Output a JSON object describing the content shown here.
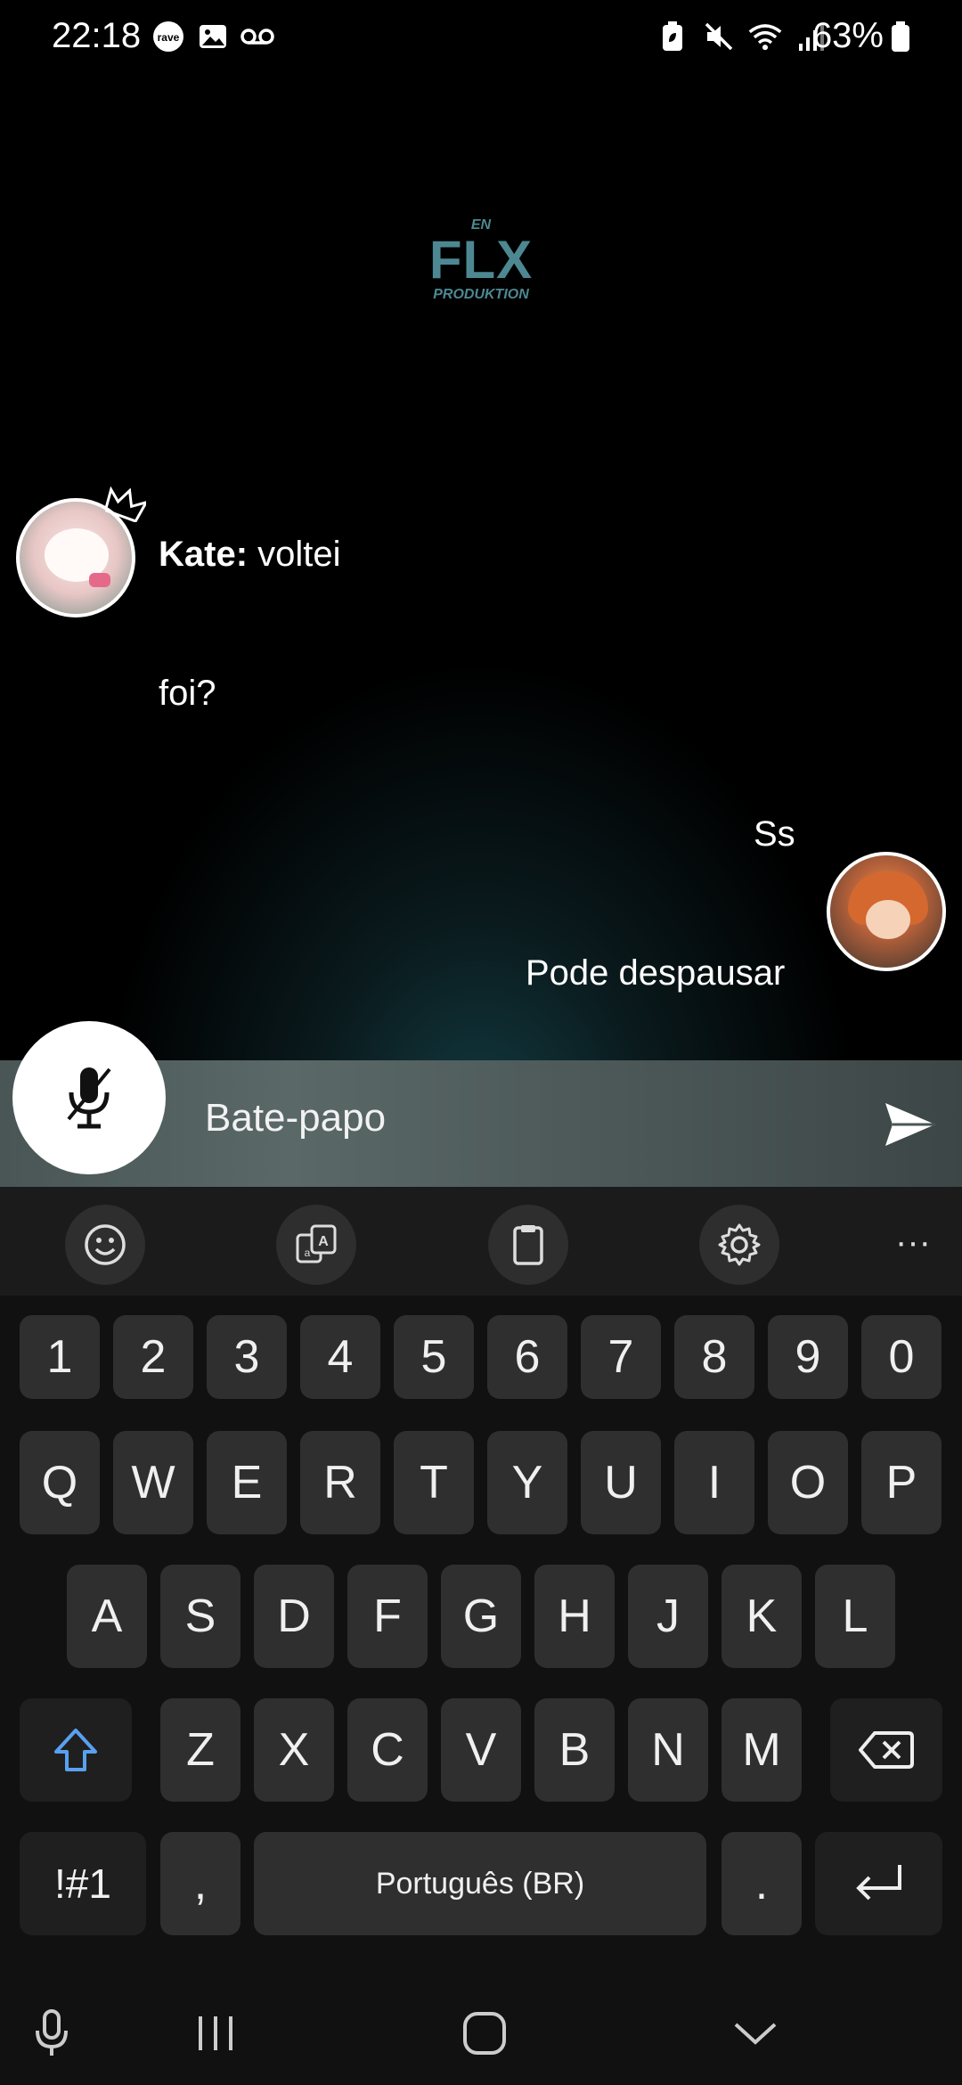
{
  "status_bar": {
    "time": "22:18",
    "battery": "63%",
    "left_icons": [
      "rave-icon",
      "image-icon",
      "voicemail-icon"
    ],
    "right_icons": [
      "battery-saver-icon",
      "mute-icon",
      "wifi-icon",
      "signal-icon"
    ]
  },
  "logo": {
    "top": "EN",
    "main": "FLX",
    "bottom": "PRODUKTION",
    "color": "#4d8892"
  },
  "messages": [
    {
      "side": "left",
      "author": "Kate:",
      "text": " voltei",
      "has_avatar": true,
      "crown": true
    },
    {
      "side": "left",
      "author": "",
      "text": "foi?",
      "has_avatar": false
    },
    {
      "side": "right",
      "author": "",
      "text": "Ss",
      "has_avatar": true
    },
    {
      "side": "right",
      "author": "",
      "text": "Pode despausar",
      "has_avatar": false
    }
  ],
  "input": {
    "placeholder": "Bate-papo",
    "mic_state": "muted",
    "send_icon": "send-icon"
  },
  "keyboard": {
    "toolbar": [
      "emoji-icon",
      "translate-icon",
      "clipboard-icon",
      "settings-icon",
      "more-icon"
    ],
    "more_label": "···",
    "row_numbers": [
      "1",
      "2",
      "3",
      "4",
      "5",
      "6",
      "7",
      "8",
      "9",
      "0"
    ],
    "row_1": [
      "Q",
      "W",
      "E",
      "R",
      "T",
      "Y",
      "U",
      "I",
      "O",
      "P"
    ],
    "row_2": [
      "A",
      "S",
      "D",
      "F",
      "G",
      "H",
      "J",
      "K",
      "L"
    ],
    "row_3": [
      "Z",
      "X",
      "C",
      "V",
      "B",
      "N",
      "M"
    ],
    "symbols_label": "!#1",
    "comma_label": ",",
    "space_label": "Português (BR)",
    "period_label": ".",
    "accent_color": "#5aa0f0"
  },
  "nav_bar": [
    "mic-icon",
    "recents-icon",
    "home-icon",
    "hide-keyboard-icon"
  ]
}
